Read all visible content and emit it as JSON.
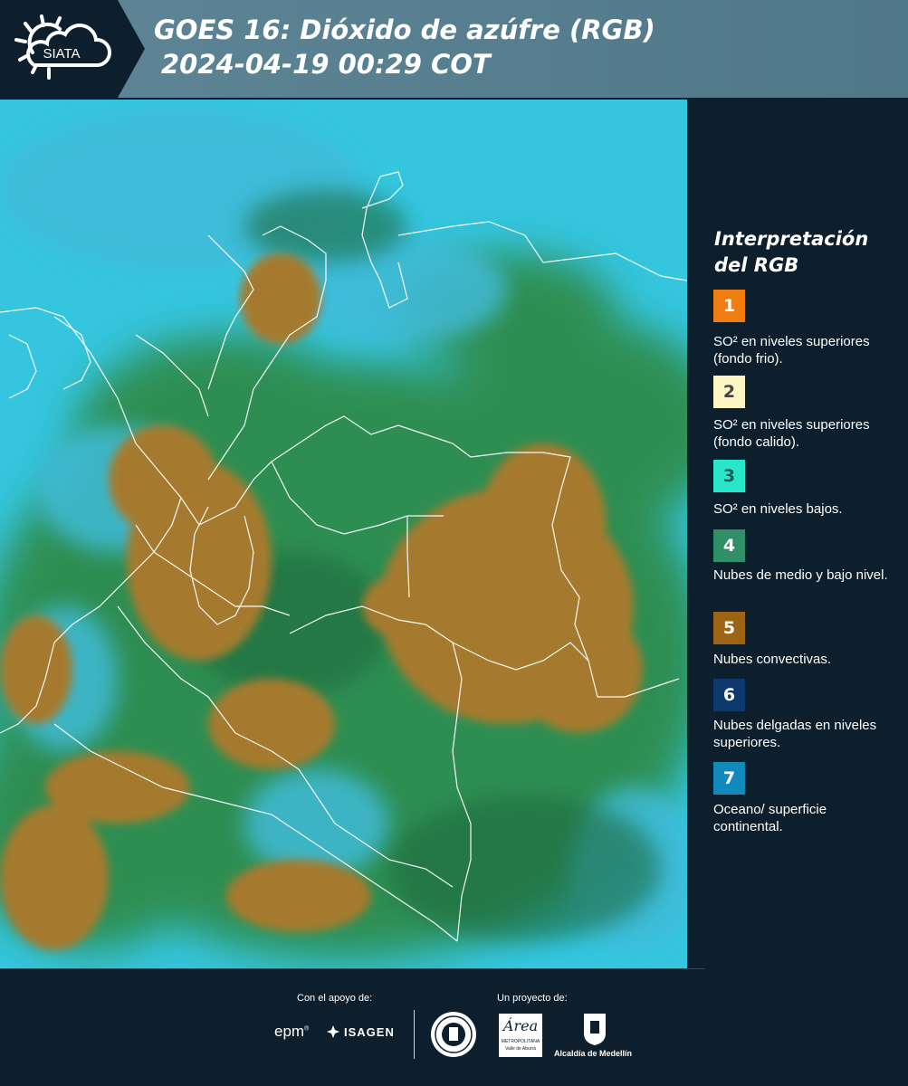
{
  "header": {
    "logo_text": "SIATA",
    "title_line1": "GOES 16: Dióxido de azúfre (RGB)",
    "title_line2": "2024-04-19 00:29 COT"
  },
  "map": {
    "description_colors": {
      "ocean": "#2fc3e0",
      "low_cloud": "#2f8d4a",
      "convective": "#a4762a",
      "border": "#ffffff"
    }
  },
  "legend": {
    "title_line1": "Interpretación",
    "title_line2": "del RGB",
    "items": [
      {
        "number": "1",
        "color": "#f07d12",
        "num_color": "#ffffff",
        "text": "SO² en niveles superiores (fondo frio)."
      },
      {
        "number": "2",
        "color": "#fdf6c4",
        "num_color": "#444444",
        "text": "SO² en niveles superiores (fondo calido)."
      },
      {
        "number": "3",
        "color": "#27e6c9",
        "num_color": "#2a5b5a",
        "text": "SO² en niveles bajos."
      },
      {
        "number": "4",
        "color": "#2f8f67",
        "num_color": "#ffffff",
        "text": "Nubes de medio y bajo nivel."
      },
      {
        "number": "5",
        "color": "#9c6414",
        "num_color": "#ffffff",
        "text": "Nubes convectivas."
      },
      {
        "number": "6",
        "color": "#0d3a6e",
        "num_color": "#ffffff",
        "text": "Nubes delgadas en niveles superiores."
      },
      {
        "number": "7",
        "color": "#1289bb",
        "num_color": "#ffffff",
        "text": "Oceano/ superficie continental."
      }
    ]
  },
  "footer": {
    "support_label": "Con el apoyo de:",
    "project_label": "Un proyecto de:",
    "sponsor_epm": "epm",
    "sponsor_isagen": "ISAGEN",
    "partner_area_line1": "Área",
    "partner_area_line2": "METROPOLITANA",
    "partner_area_line3": "Valle de Aburrá",
    "partner_alcaldia": "Alcaldía de Medellín"
  }
}
